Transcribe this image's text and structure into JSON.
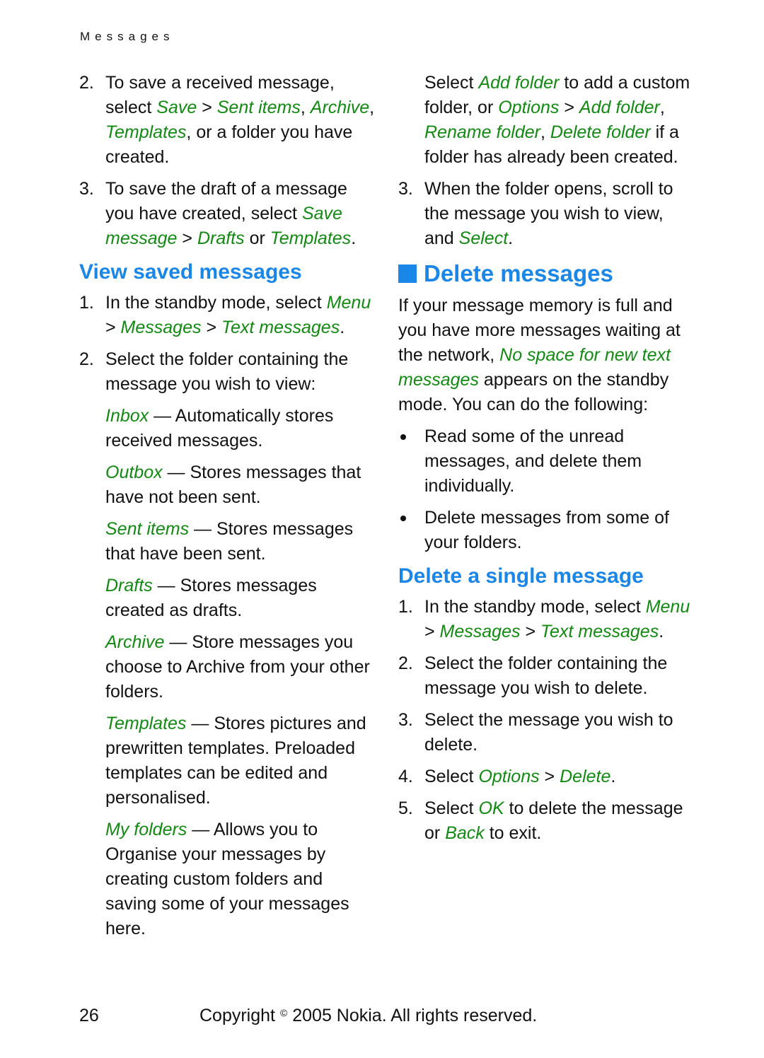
{
  "running_head": "Messages",
  "left_column": {
    "intro_steps": [
      {
        "num": "2.",
        "parts": [
          {
            "t": "To save a received message, select ",
            "s": "plain"
          },
          {
            "t": "Save",
            "s": "link"
          },
          {
            "t": " > ",
            "s": "plain"
          },
          {
            "t": "Sent items",
            "s": "link"
          },
          {
            "t": ", ",
            "s": "plain"
          },
          {
            "t": "Archive",
            "s": "link"
          },
          {
            "t": ", ",
            "s": "plain"
          },
          {
            "t": "Templates",
            "s": "link"
          },
          {
            "t": ", or a folder you have created.",
            "s": "plain"
          }
        ]
      },
      {
        "num": "3.",
        "parts": [
          {
            "t": "To save the draft of a message you have created, select ",
            "s": "plain"
          },
          {
            "t": "Save message",
            "s": "link"
          },
          {
            "t": " > ",
            "s": "plain"
          },
          {
            "t": "Drafts",
            "s": "link"
          },
          {
            "t": " or ",
            "s": "plain"
          },
          {
            "t": "Templates",
            "s": "link"
          },
          {
            "t": ".",
            "s": "plain"
          }
        ]
      }
    ],
    "view_heading": "View saved messages",
    "view_steps": [
      {
        "num": "1.",
        "parts": [
          {
            "t": "In the standby mode, select ",
            "s": "plain"
          },
          {
            "t": "Menu",
            "s": "link"
          },
          {
            "t": " > ",
            "s": "plain"
          },
          {
            "t": "Messages",
            "s": "link"
          },
          {
            "t": " > ",
            "s": "plain"
          },
          {
            "t": "Text messages",
            "s": "link"
          },
          {
            "t": ".",
            "s": "plain"
          }
        ]
      },
      {
        "num": "2.",
        "parts": [
          {
            "t": "Select the folder containing the message you wish to view:",
            "s": "plain"
          }
        ]
      }
    ],
    "folders": [
      {
        "name": "Inbox",
        "desc": " — Automatically stores received messages."
      },
      {
        "name": "Outbox",
        "desc": " — Stores messages that have not been sent."
      },
      {
        "name": "Sent items",
        "desc": " — Stores messages that have been sent."
      },
      {
        "name": "Drafts",
        "desc": " — Stores messages created as drafts."
      },
      {
        "name": "Archive",
        "desc": " — Store messages you choose to Archive from your other folders."
      },
      {
        "name": "Templates",
        "desc": " — Stores pictures and prewritten templates. Preloaded templates can be edited and personalised."
      },
      {
        "name": "My folders",
        "desc": " — Allows you to Organise your messages by creating custom folders and saving some of your messages here."
      }
    ]
  },
  "right_column": {
    "continued": {
      "parts": [
        {
          "t": "Select ",
          "s": "plain"
        },
        {
          "t": "Add folder",
          "s": "link"
        },
        {
          "t": " to add a custom folder, or ",
          "s": "plain"
        },
        {
          "t": "Options",
          "s": "link"
        },
        {
          "t": " > ",
          "s": "plain"
        },
        {
          "t": "Add folder",
          "s": "link"
        },
        {
          "t": ", ",
          "s": "plain"
        },
        {
          "t": "Rename folder",
          "s": "link"
        },
        {
          "t": ", ",
          "s": "plain"
        },
        {
          "t": "Delete folder",
          "s": "link"
        },
        {
          "t": " if a folder has already been created.",
          "s": "plain"
        }
      ]
    },
    "step3": {
      "num": "3.",
      "parts": [
        {
          "t": "When the folder opens, scroll to the message you wish to view, and ",
          "s": "plain"
        },
        {
          "t": "Select",
          "s": "link"
        },
        {
          "t": ".",
          "s": "plain"
        }
      ]
    },
    "delete_heading": "Delete messages",
    "delete_intro": [
      {
        "t": "If your message memory is full and you have more messages waiting at the network, ",
        "s": "plain"
      },
      {
        "t": "No space for new text messages",
        "s": "link"
      },
      {
        "t": " appears on the standby mode. You can do the following:",
        "s": "plain"
      }
    ],
    "bullets": [
      "Read some of the unread messages, and delete them individually.",
      "Delete messages from some of your folders."
    ],
    "single_heading": "Delete a single message",
    "single_steps": [
      {
        "num": "1.",
        "parts": [
          {
            "t": "In the standby mode, select ",
            "s": "plain"
          },
          {
            "t": "Menu",
            "s": "link"
          },
          {
            "t": " > ",
            "s": "plain"
          },
          {
            "t": "Messages",
            "s": "link"
          },
          {
            "t": " > ",
            "s": "plain"
          },
          {
            "t": "Text messages",
            "s": "link"
          },
          {
            "t": ".",
            "s": "plain"
          }
        ]
      },
      {
        "num": "2.",
        "parts": [
          {
            "t": "Select the folder containing the message you wish to delete.",
            "s": "plain"
          }
        ]
      },
      {
        "num": "3.",
        "parts": [
          {
            "t": "Select the message you wish to delete.",
            "s": "plain"
          }
        ]
      },
      {
        "num": "4.",
        "parts": [
          {
            "t": "Select ",
            "s": "plain"
          },
          {
            "t": "Options",
            "s": "link"
          },
          {
            "t": " > ",
            "s": "plain"
          },
          {
            "t": "Delete",
            "s": "link"
          },
          {
            "t": ".",
            "s": "plain"
          }
        ]
      },
      {
        "num": "5.",
        "parts": [
          {
            "t": "Select ",
            "s": "plain"
          },
          {
            "t": "OK",
            "s": "link"
          },
          {
            "t": " to delete the message or ",
            "s": "plain"
          },
          {
            "t": "Back",
            "s": "link"
          },
          {
            "t": " to exit.",
            "s": "plain"
          }
        ]
      }
    ]
  },
  "footer": {
    "page_number": "26",
    "copyright_prefix": "Copyright",
    "copyright_symbol": "©",
    "copyright_rest": "2005 Nokia. All rights reserved."
  },
  "colors": {
    "heading_blue": "#1a86e8",
    "link_green": "#128a12",
    "text": "#111111"
  }
}
